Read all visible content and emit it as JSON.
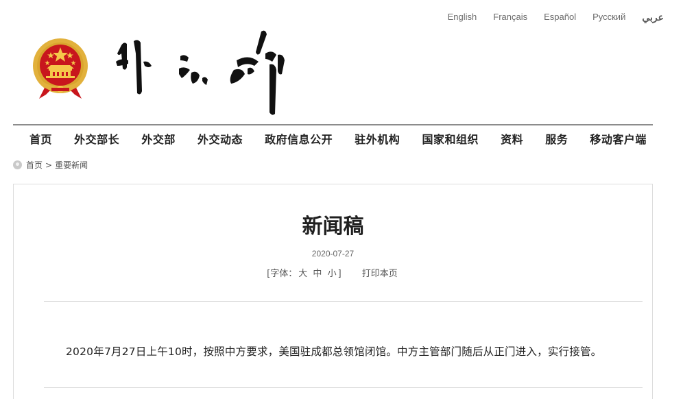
{
  "languages": [
    {
      "label": "English"
    },
    {
      "label": "Français"
    },
    {
      "label": "Español"
    },
    {
      "label": "Русский"
    },
    {
      "label": "عربي"
    }
  ],
  "brand": {
    "emblem_icon": "national-emblem-icon",
    "calligraphy_icon": "ministry-calligraphy-logo",
    "calligraphy_text": "外交部",
    "emblem_colors": {
      "red": "#c8161d",
      "gold": "#e2b13c"
    }
  },
  "nav": {
    "items": [
      {
        "label": "首页"
      },
      {
        "label": "外交部长"
      },
      {
        "label": "外交部"
      },
      {
        "label": "外交动态"
      },
      {
        "label": "政府信息公开"
      },
      {
        "label": "驻外机构"
      },
      {
        "label": "国家和组织"
      },
      {
        "label": "资料"
      },
      {
        "label": "服务"
      },
      {
        "label": "移动客户端"
      }
    ]
  },
  "breadcrumb": {
    "home": "首页",
    "separator": ">",
    "current": "重要新闻"
  },
  "article": {
    "title": "新闻稿",
    "date": "2020-07-27",
    "font_tools": {
      "open": "[字体：",
      "large": "大",
      "medium": "中",
      "small": "小",
      "close": "]"
    },
    "print_label": "打印本页",
    "body": "2020年7月27日上午10时，按照中方要求，美国驻成都总领馆闭馆。中方主管部门随后从正门进入，实行接管。"
  }
}
